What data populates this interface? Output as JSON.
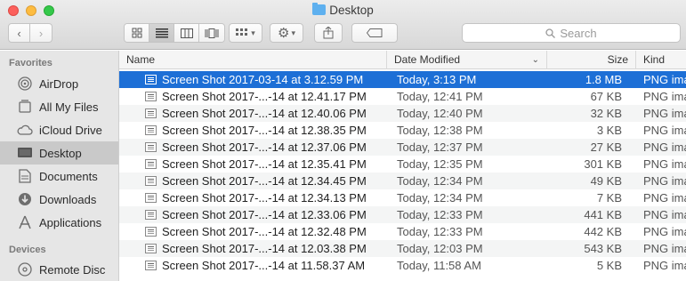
{
  "window": {
    "title": "Desktop",
    "title_icon": "folder-icon"
  },
  "toolbar": {
    "back_icon": "‹",
    "forward_icon": "›",
    "arrange_icon": "▾",
    "action_icon": "▾",
    "search_placeholder": "Search"
  },
  "sidebar": {
    "favorites_heading": "Favorites",
    "favorites": [
      {
        "label": "AirDrop",
        "icon": "airdrop-icon"
      },
      {
        "label": "All My Files",
        "icon": "all-files-icon"
      },
      {
        "label": "iCloud Drive",
        "icon": "cloud-icon"
      },
      {
        "label": "Desktop",
        "icon": "desktop-icon",
        "selected": true
      },
      {
        "label": "Documents",
        "icon": "documents-icon"
      },
      {
        "label": "Downloads",
        "icon": "downloads-icon"
      },
      {
        "label": "Applications",
        "icon": "applications-icon"
      }
    ],
    "devices_heading": "Devices",
    "devices": [
      {
        "label": "Remote Disc",
        "icon": "disc-icon"
      }
    ]
  },
  "list": {
    "columns": {
      "name": "Name",
      "date": "Date Modified",
      "size": "Size",
      "kind": "Kind"
    },
    "rows": [
      {
        "name": "Screen Shot 2017-03-14 at 3.12.59 PM",
        "date": "Today, 3:13 PM",
        "size": "1.8 MB",
        "kind": "PNG ima",
        "selected": true
      },
      {
        "name": "Screen Shot 2017-...-14 at 12.41.17 PM",
        "date": "Today, 12:41 PM",
        "size": "67 KB",
        "kind": "PNG ima"
      },
      {
        "name": "Screen Shot 2017-...-14 at 12.40.06 PM",
        "date": "Today, 12:40 PM",
        "size": "32 KB",
        "kind": "PNG ima"
      },
      {
        "name": "Screen Shot 2017-...-14 at 12.38.35 PM",
        "date": "Today, 12:38 PM",
        "size": "3 KB",
        "kind": "PNG ima"
      },
      {
        "name": "Screen Shot 2017-...-14 at 12.37.06 PM",
        "date": "Today, 12:37 PM",
        "size": "27 KB",
        "kind": "PNG ima"
      },
      {
        "name": "Screen Shot 2017-...-14 at 12.35.41 PM",
        "date": "Today, 12:35 PM",
        "size": "301 KB",
        "kind": "PNG ima"
      },
      {
        "name": "Screen Shot 2017-...-14 at 12.34.45 PM",
        "date": "Today, 12:34 PM",
        "size": "49 KB",
        "kind": "PNG ima"
      },
      {
        "name": "Screen Shot 2017-...-14 at 12.34.13 PM",
        "date": "Today, 12:34 PM",
        "size": "7 KB",
        "kind": "PNG ima"
      },
      {
        "name": "Screen Shot 2017-...-14 at 12.33.06 PM",
        "date": "Today, 12:33 PM",
        "size": "441 KB",
        "kind": "PNG ima"
      },
      {
        "name": "Screen Shot 2017-...-14 at 12.32.48 PM",
        "date": "Today, 12:33 PM",
        "size": "442 KB",
        "kind": "PNG ima"
      },
      {
        "name": "Screen Shot 2017-...-14 at 12.03.38 PM",
        "date": "Today, 12:03 PM",
        "size": "543 KB",
        "kind": "PNG ima"
      },
      {
        "name": "Screen Shot 2017-...-14 at 11.58.37 AM",
        "date": "Today, 11:58 AM",
        "size": "5 KB",
        "kind": "PNG ima"
      }
    ]
  },
  "colors": {
    "selection": "#1d6fd6",
    "sidebar_bg": "#e6e6e6",
    "folder": "#5eb0ef"
  }
}
